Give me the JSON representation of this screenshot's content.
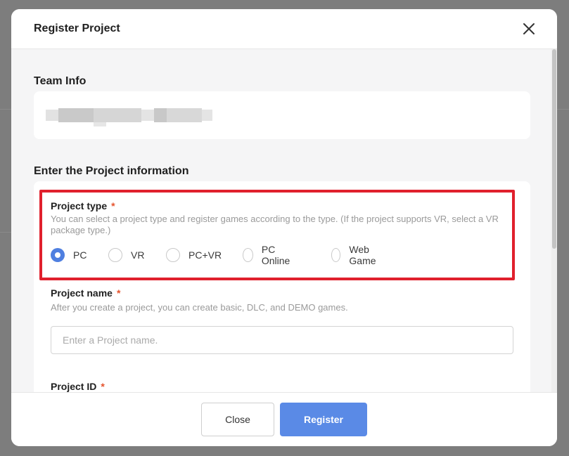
{
  "modal": {
    "title": "Register Project"
  },
  "team_info": {
    "heading": "Team Info"
  },
  "project_info": {
    "heading": "Enter the Project information",
    "project_type": {
      "label": "Project type",
      "required_mark": "*",
      "description": "You can select a project type and register games according to the type. (If the project supports VR, select a VR package type.)",
      "options": [
        {
          "label": "PC",
          "checked": true
        },
        {
          "label": "VR",
          "checked": false
        },
        {
          "label": "PC+VR",
          "checked": false
        },
        {
          "label": "PC Online",
          "checked": false
        },
        {
          "label": "Web Game",
          "checked": false
        }
      ]
    },
    "project_name": {
      "label": "Project name",
      "required_mark": "*",
      "description": "After you create a project, you can create basic, DLC, and DEMO games.",
      "placeholder": "Enter a Project name.",
      "value": ""
    },
    "project_id": {
      "label": "Project ID",
      "required_mark": "*"
    }
  },
  "footer": {
    "close_label": "Close",
    "register_label": "Register"
  },
  "colors": {
    "accent": "#5a8ae6",
    "radio_checked": "#4f7fe0",
    "required": "#e5532d",
    "highlight": "#e0202d"
  },
  "icons": {
    "close": "close-icon"
  }
}
